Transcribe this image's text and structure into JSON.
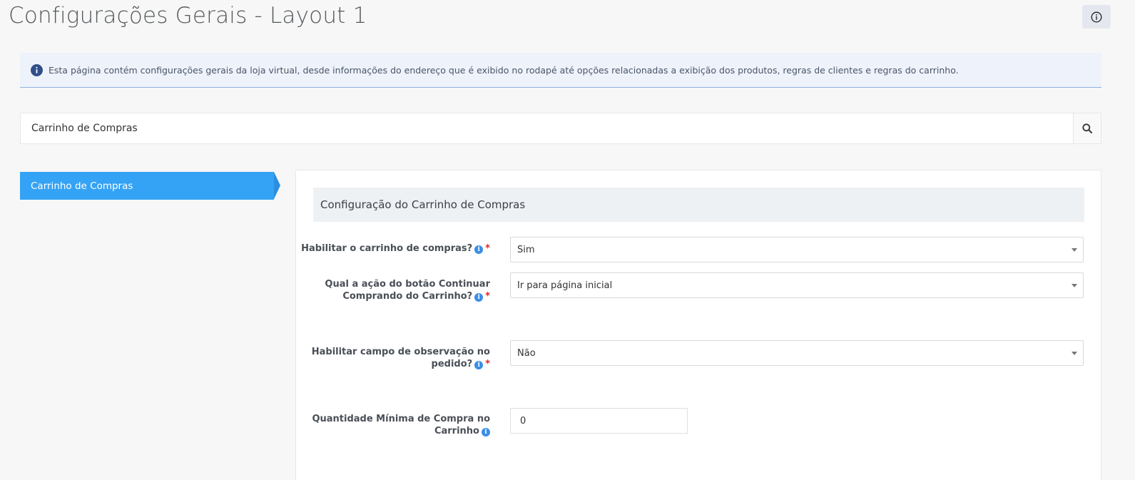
{
  "page": {
    "title": "Configurações Gerais - Layout 1",
    "help_icon": "info-circle-icon"
  },
  "alert": {
    "icon": "info-circle-icon",
    "text": "Esta página contém configurações gerais da loja virtual, desde informações do endereço que é exibido no rodapé até opções relacionadas a exibição dos produtos, regras de clientes e regras do carrinho."
  },
  "search": {
    "value": "Carrinho de Compras",
    "icon": "search-icon"
  },
  "sidebar": {
    "items": [
      {
        "label": "Carrinho de Compras",
        "active": true
      }
    ]
  },
  "section": {
    "title": "Configuração do Carrinho de Compras",
    "fields": [
      {
        "label_line1": "Habilitar o carrinho de compras?",
        "label_line2": "",
        "required": "*",
        "value": "Sim",
        "type": "select"
      },
      {
        "label_line1": "Qual a ação do botão Continuar",
        "label_line2": "Comprando do Carrinho?",
        "required": "*",
        "value": "Ir para página inicial",
        "type": "select"
      },
      {
        "label_line1": "Habilitar campo de observação no",
        "label_line2": "pedido?",
        "required": "*",
        "value": "Não",
        "type": "select"
      },
      {
        "label_line1": "Quantidade Mínima de Compra no",
        "label_line2": "Carrinho",
        "required": "",
        "value": "0",
        "type": "text"
      }
    ]
  },
  "colors": {
    "accent": "#35a3f5",
    "info_icon": "#3a8ee6",
    "required": "#e02424",
    "alert_bg": "#eef3fb"
  }
}
